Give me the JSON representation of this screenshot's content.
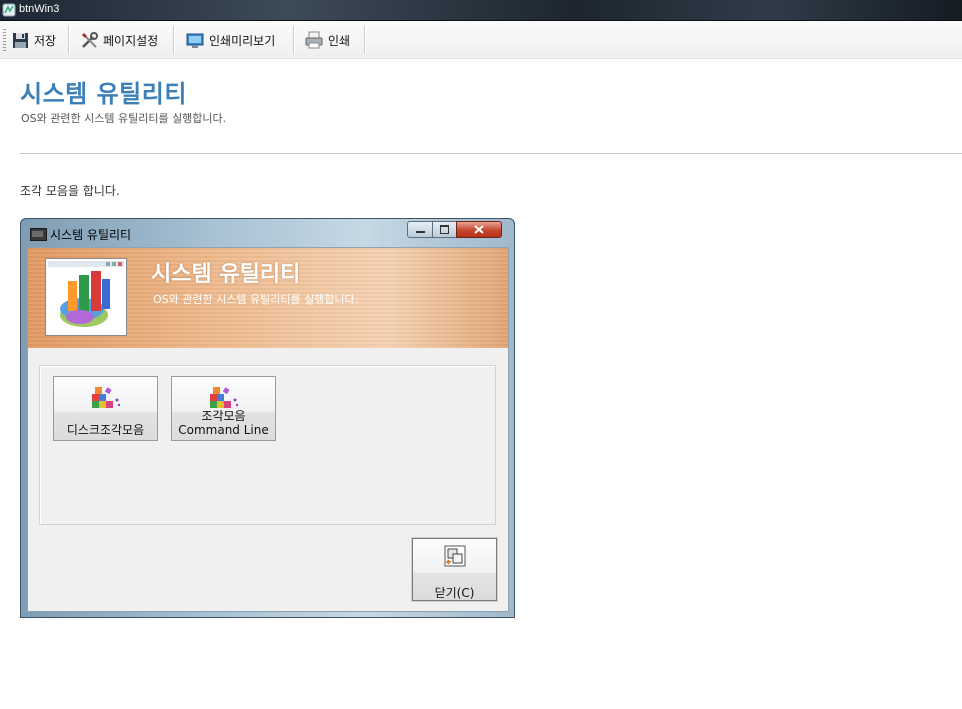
{
  "window": {
    "title": "btnWin3"
  },
  "toolbar": {
    "save": "저장",
    "page_setup": "페이지설정",
    "print_preview": "인쇄미리보기",
    "print": "인쇄"
  },
  "page": {
    "title": "시스템 유틸리티",
    "subtitle": "OS와 관련한 시스템 유틸리티를 실행합니다.",
    "description": "조각 모음을 합니다."
  },
  "dialog": {
    "title": "시스템 유틸리티",
    "banner_title": "시스템 유틸리티",
    "banner_subtitle": "OS와 관련한 시스템 유틸리티를 실행합니다.",
    "buttons": {
      "defrag": "디스크조각모음",
      "defrag_cmd_line1": "조각모음",
      "defrag_cmd_line2": "Command Line",
      "close": "닫기(C)"
    }
  },
  "colors": {
    "page_title": "#3d7fb7",
    "banner": "#e29a63"
  }
}
